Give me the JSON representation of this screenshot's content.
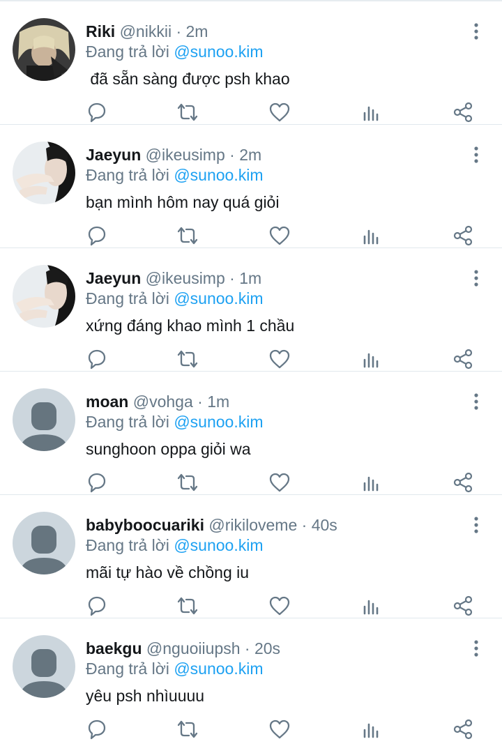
{
  "reply_prefix": "Đang trả lời",
  "icons": {
    "reply": "comment-icon",
    "retweet": "retweet-icon",
    "like": "heart-icon",
    "stats": "analytics-icon",
    "share": "share-icon",
    "more": "more-vertical-icon"
  },
  "colors": {
    "text": "#14171a",
    "secondary": "#657786",
    "mention": "#1da1f2",
    "divider": "#e1e8ed",
    "default_avatar_bg": "#ccd6dd",
    "default_avatar_fg": "#66757f"
  },
  "tweets": [
    {
      "name": "Riki",
      "handle": "@nikkii",
      "time": "· 2m",
      "mention": "@sunoo.kim",
      "text": " đã sẵn sàng được psh khao",
      "avatar": "photo-blonde"
    },
    {
      "name": "Jaeyun",
      "handle": "@ikeusimp",
      "time": "· 2m",
      "mention": "@sunoo.kim",
      "text": "bạn mình hôm nay quá giỏi",
      "avatar": "photo-dark"
    },
    {
      "name": "Jaeyun",
      "handle": "@ikeusimp",
      "time": "· 1m",
      "mention": "@sunoo.kim",
      "text": "xứng đáng khao mình 1 chầu",
      "avatar": "photo-dark"
    },
    {
      "name": "moan",
      "handle": "@vohga",
      "time": "· 1m",
      "mention": "@sunoo.kim",
      "text": "sunghoon oppa giỏi wa",
      "avatar": "default"
    },
    {
      "name": "babyboocuariki",
      "handle": "@rikiloveme",
      "time": "· 40s",
      "mention": "@sunoo.kim",
      "text": "mãi tự hào về chồng iu",
      "avatar": "default"
    },
    {
      "name": "baekgu",
      "handle": "@nguoiiupsh",
      "time": "· 20s",
      "mention": "@sunoo.kim",
      "text": "yêu psh nhìuuuu",
      "avatar": "default"
    }
  ]
}
